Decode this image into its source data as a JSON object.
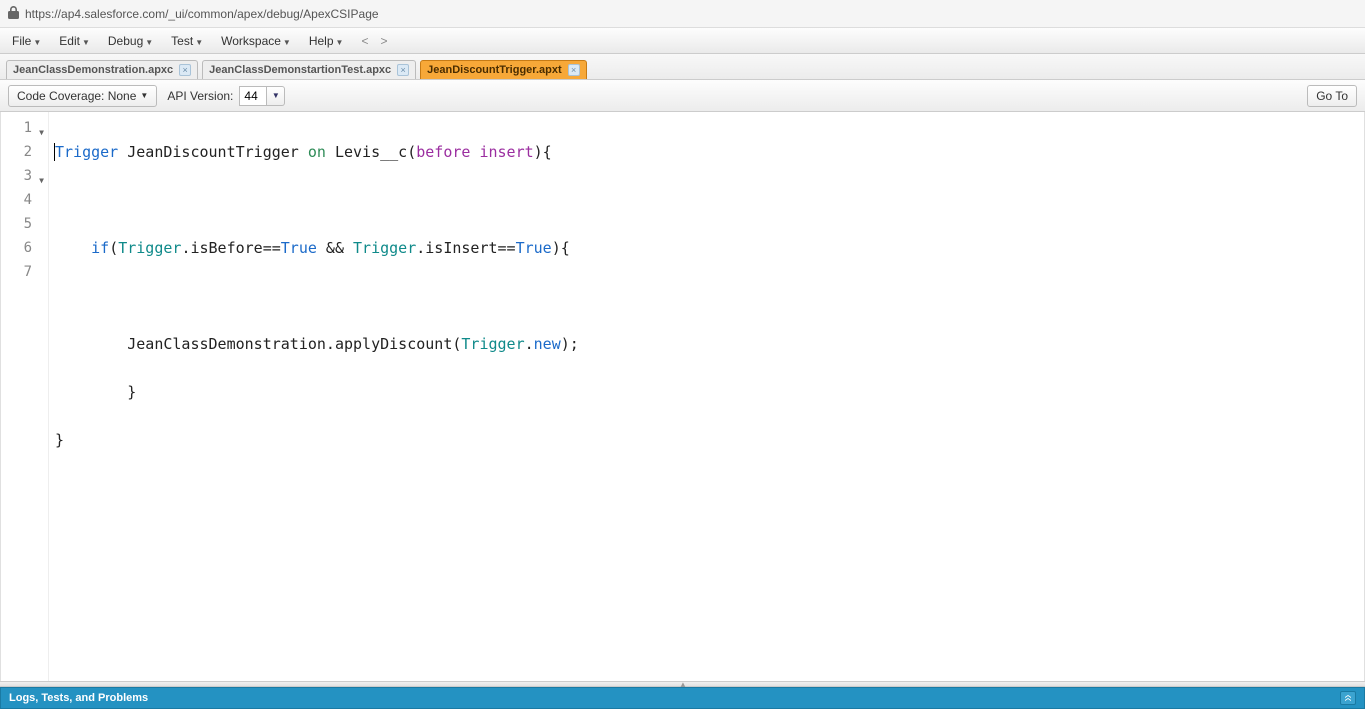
{
  "url": "https://ap4.salesforce.com/_ui/common/apex/debug/ApexCSIPage",
  "menu": {
    "file": "File",
    "edit": "Edit",
    "debug": "Debug",
    "test": "Test",
    "workspace": "Workspace",
    "help": "Help",
    "back": "<",
    "forward": ">"
  },
  "tabs": [
    {
      "label": "JeanClassDemonstration.apxc",
      "active": false
    },
    {
      "label": "JeanClassDemonstartionTest.apxc",
      "active": false
    },
    {
      "label": "JeanDiscountTrigger.apxt",
      "active": true
    }
  ],
  "toolbar": {
    "code_coverage": "Code Coverage: None",
    "api_version_label": "API Version:",
    "api_version_value": "44",
    "goto": "Go To"
  },
  "code": {
    "lines": [
      "1",
      "2",
      "3",
      "4",
      "5",
      "6",
      "7"
    ],
    "l1": {
      "a": "Trigger",
      "b": " JeanDiscountTrigger ",
      "c": "on",
      "d": " Levis__c(",
      "e": "before",
      "f": " ",
      "g": "insert",
      "h": "){"
    },
    "l3": {
      "a": "    ",
      "b": "if",
      "c": "(",
      "d": "Trigger",
      "e": ".isBefore==",
      "f": "True",
      "g": " && ",
      "h": "Trigger",
      "i": ".isInsert==",
      "j": "True",
      "k": "){"
    },
    "l5": {
      "a": "        JeanClassDemonstration.applyDiscount(",
      "b": "Trigger",
      "c": ".",
      "d": "new",
      "e": ");"
    },
    "l6": "        }",
    "l7": "}"
  },
  "bottom_panel": "Logs, Tests, and Problems"
}
